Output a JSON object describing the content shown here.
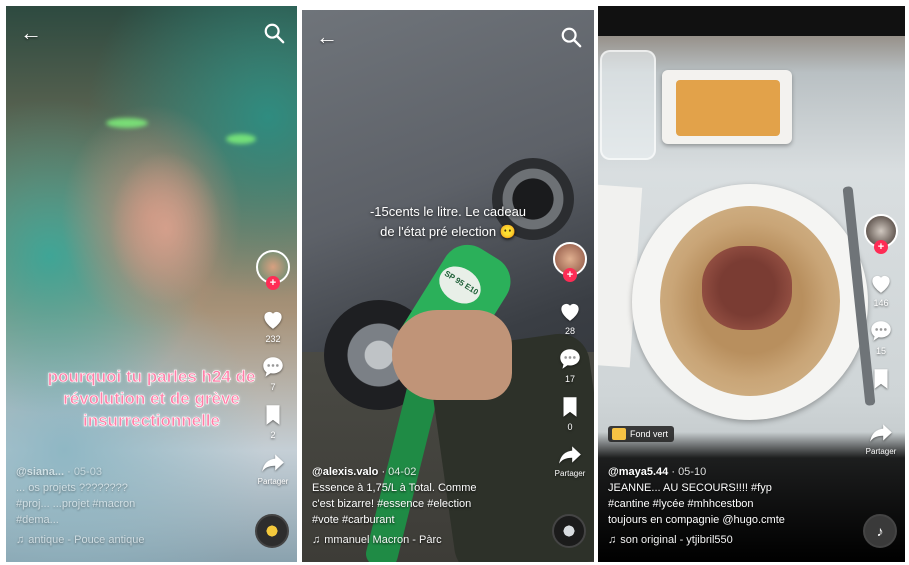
{
  "panels": [
    {
      "overlay_text": "pourquoi tu parles h24 de révolution et de grève insurrectionnelle",
      "counts": {
        "likes": "232",
        "comments": "7",
        "saves": "2"
      },
      "share_label": "Partager",
      "caption": {
        "user": "@siana...",
        "date": "05-03",
        "line1": "... os projets ????????",
        "line2": "#proj... ...projet #macron",
        "line3": "#dema...",
        "sound": "antique - Pouce antique"
      }
    },
    {
      "overlay_text": "-15cents le litre. Le cadeau de l'état pré election 😶",
      "pump_label": "SP 95 E10",
      "counts": {
        "likes": "28",
        "comments": "17",
        "saves": "0"
      },
      "share_label": "Partager",
      "caption": {
        "user": "@alexis.valo",
        "date": "04-02",
        "line1": "Essence à 1,75/L à Total. Comme",
        "line2": "c'est bizarre! #essence #election",
        "line3": "#vote #carburant",
        "sound": "mmanuel Macron - Pàrc"
      }
    },
    {
      "badge": "Fond vert",
      "counts": {
        "likes": "146",
        "comments": "15"
      },
      "share_label": "Partager",
      "caption": {
        "user": "@maya5.44",
        "date": "05-10",
        "line1": "JEANNE... AU SECOURS!!!! #fyp",
        "line2": "#cantine #lycée #mhhcestbon",
        "line3": "toujours en compagnie @hugo.cmte",
        "sound": "son original - ytjibril550"
      }
    }
  ],
  "icons": {
    "back": "back-arrow-icon",
    "search": "search-icon",
    "like": "heart-icon",
    "comment": "comment-icon",
    "save": "bookmark-icon",
    "share": "share-arrow-icon",
    "music": "music-note-icon"
  },
  "colors": {
    "tiktok_red": "#fe2c55",
    "overlay_pink": "#ff7fa8",
    "badge_yellow": "#f6c244"
  }
}
